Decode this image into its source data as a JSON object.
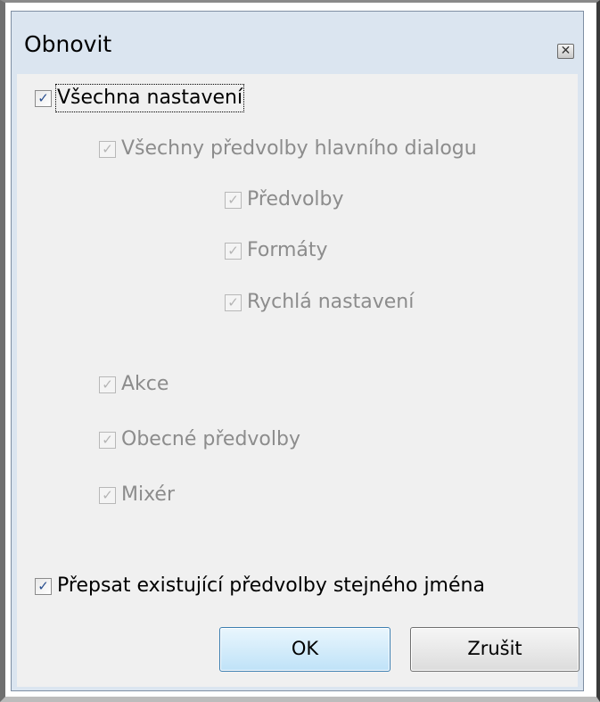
{
  "window": {
    "title": "Obnovit",
    "close_symbol": "✕"
  },
  "options": {
    "all_settings": {
      "label": "Všechna nastavení",
      "checked": true,
      "enabled": true
    },
    "main_dialog_presets": {
      "label": "Všechny předvolby hlavního dialogu",
      "checked": true,
      "enabled": false
    },
    "presets": {
      "label": "Předvolby",
      "checked": true,
      "enabled": false
    },
    "formats": {
      "label": "Formáty",
      "checked": true,
      "enabled": false
    },
    "quick_settings": {
      "label": "Rychlá nastavení",
      "checked": true,
      "enabled": false
    },
    "actions": {
      "label": "Akce",
      "checked": true,
      "enabled": false
    },
    "general_presets": {
      "label": "Obecné předvolby",
      "checked": true,
      "enabled": false
    },
    "mixer": {
      "label": "Mixér",
      "checked": true,
      "enabled": false
    },
    "overwrite_existing": {
      "label": "Přepsat existující předvolby stejného jména",
      "checked": true,
      "enabled": true
    }
  },
  "check_glyph": "✓",
  "buttons": {
    "ok": "OK",
    "cancel": "Zrušit"
  }
}
